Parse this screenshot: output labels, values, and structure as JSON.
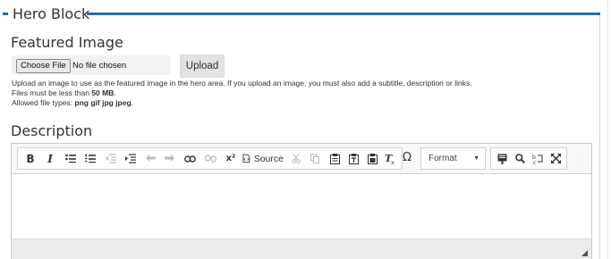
{
  "section": {
    "legend": "Hero Block"
  },
  "featured_image": {
    "title": "Featured Image",
    "choose_label": "Choose File",
    "no_file_text": "No file chosen",
    "upload_label": "Upload",
    "help_line1": "Upload an image to use as the featured image in the hero area. If you upload an image, you must also add a subtitle, description or links.",
    "help_line2_prefix": "Files must be less than ",
    "help_line2_value": "50 MB",
    "help_line2_suffix": ".",
    "help_line3_prefix": "Allowed file types: ",
    "help_line3_value": "png gif jpg jpeg",
    "help_line3_suffix": "."
  },
  "description": {
    "title": "Description",
    "toolbar": {
      "bold": "B",
      "italic": "I",
      "superscript": "x²",
      "source": "Source",
      "omega": "Ω",
      "format": "Format",
      "format_arrow": "▼"
    },
    "icons": [
      "bold-icon",
      "italic-icon",
      "bulleted-list-icon",
      "numbered-list-icon",
      "outdent-icon",
      "indent-icon",
      "undo-icon",
      "redo-icon",
      "link-icon",
      "unlink-icon",
      "superscript-icon",
      "source-icon",
      "cut-icon",
      "copy-icon",
      "paste-icon",
      "paste-text-icon",
      "paste-word-icon",
      "remove-format-icon",
      "special-char-icon",
      "template-icon",
      "find-icon",
      "replace-icon",
      "maximize-icon"
    ]
  }
}
